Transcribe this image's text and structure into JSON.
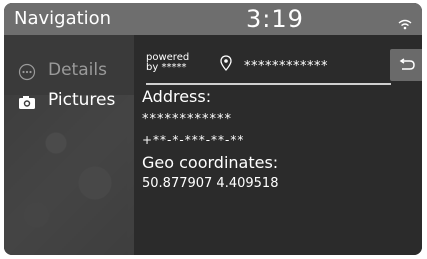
{
  "header": {
    "title": "Navigation",
    "time": "3:19"
  },
  "sidebar": {
    "items": [
      {
        "label": "Details",
        "icon": "more-dots-icon"
      },
      {
        "label": "Pictures",
        "icon": "camera-icon"
      }
    ]
  },
  "details": {
    "powered_line1": "powered",
    "powered_line2": "by *****",
    "provider_name": "************",
    "address_label": "Address:",
    "address_line1": "************",
    "address_line2": "+**-*-***-**-**",
    "geo_label": "Geo coordinates:",
    "geo_value": "50.877907 4.409518"
  },
  "colors": {
    "header_bg": "#6e6e6e",
    "sidebar_bg": "#3a3a3a",
    "content_bg": "#2b2b2b",
    "button_bg": "#6a6a6a"
  }
}
